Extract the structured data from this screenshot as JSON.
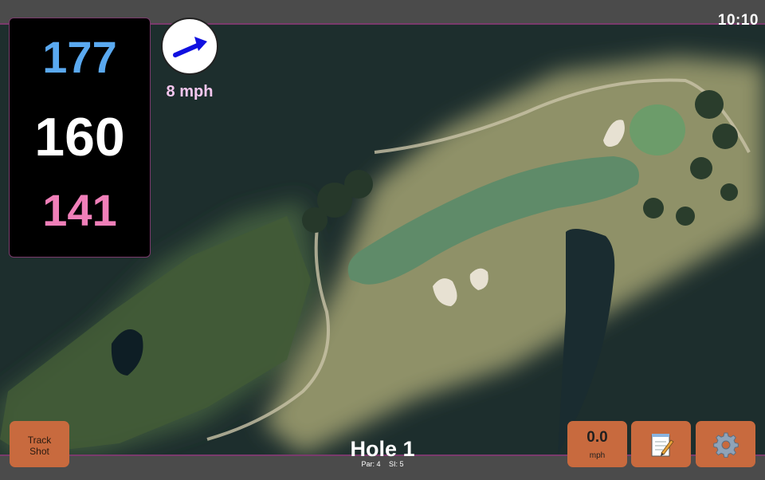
{
  "status_bar": {
    "time": "10:10"
  },
  "distances": {
    "back": "177",
    "middle": "160",
    "front": "141"
  },
  "wind": {
    "speed": "8 mph",
    "arrow_icon": "wind-direction-arrow-icon",
    "arrow_color": "#1010e0"
  },
  "track_shot": {
    "line1": "Track",
    "line2": "Shot"
  },
  "hole": {
    "title": "Hole 1",
    "par": "Par: 4",
    "stroke_index": "SI: 5"
  },
  "speed": {
    "value": "0.0",
    "unit": "mph"
  },
  "toolbar": {
    "notes_icon": "notepad-icon",
    "settings_icon": "gear-icon"
  },
  "colors": {
    "accent_border": "#7a3a6c",
    "button": "#c86a3e",
    "back_distance": "#5aa9f0",
    "front_distance": "#f07fb9",
    "wind_speed_text": "#f5c7ef"
  }
}
